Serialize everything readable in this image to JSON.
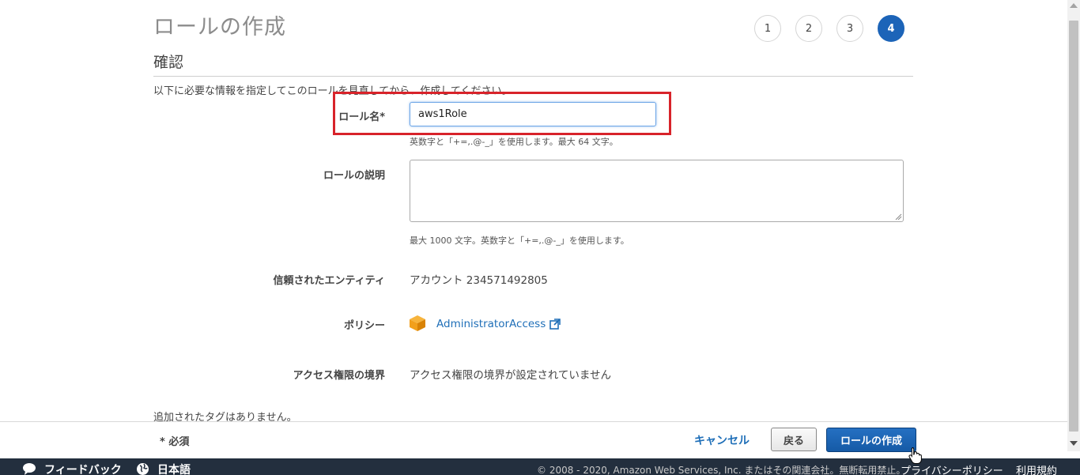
{
  "header": {
    "title": "ロールの作成",
    "steps": [
      "1",
      "2",
      "3",
      "4"
    ],
    "active_step": "4"
  },
  "section": {
    "title": "確認",
    "intro": "以下に必要な情報を指定してこのロールを見直してから、作成してください。"
  },
  "form": {
    "role_name": {
      "label": "ロール名*",
      "value": "aws1Role",
      "hint": "英数字と「+=,.@-_」を使用します。最大 64 文字。"
    },
    "role_description": {
      "label": "ロールの説明",
      "value": "",
      "hint": "最大 1000 文字。英数字と「+=,.@-_」を使用します。"
    },
    "trusted_entity": {
      "label": "信頼されたエンティティ",
      "value": "アカウント 234571492805"
    },
    "policy": {
      "label": "ポリシー",
      "link": "AdministratorAccess",
      "icon": "aws-managed-policy-cube-icon"
    },
    "permissions_boundary": {
      "label": "アクセス権限の境界",
      "value": "アクセス権限の境界が設定されていません"
    },
    "tags_note": "追加されたタグはありません。"
  },
  "actions": {
    "required_note": "* 必須",
    "cancel": "キャンセル",
    "back": "戻る",
    "create": "ロールの作成"
  },
  "footer": {
    "feedback": "フィードバック",
    "language": "日本語",
    "copyright": "© 2008 - 2020, Amazon Web Services, Inc. またはその関連会社。無断転用禁止。",
    "privacy": "プライバシーポリシー",
    "terms": "利用規約"
  },
  "colors": {
    "accent": "#1c64b8",
    "link": "#1f6fb8",
    "highlight_box": "#d8232a",
    "footer_bg": "#232f3e",
    "policy_icon": "#f2a01c"
  }
}
